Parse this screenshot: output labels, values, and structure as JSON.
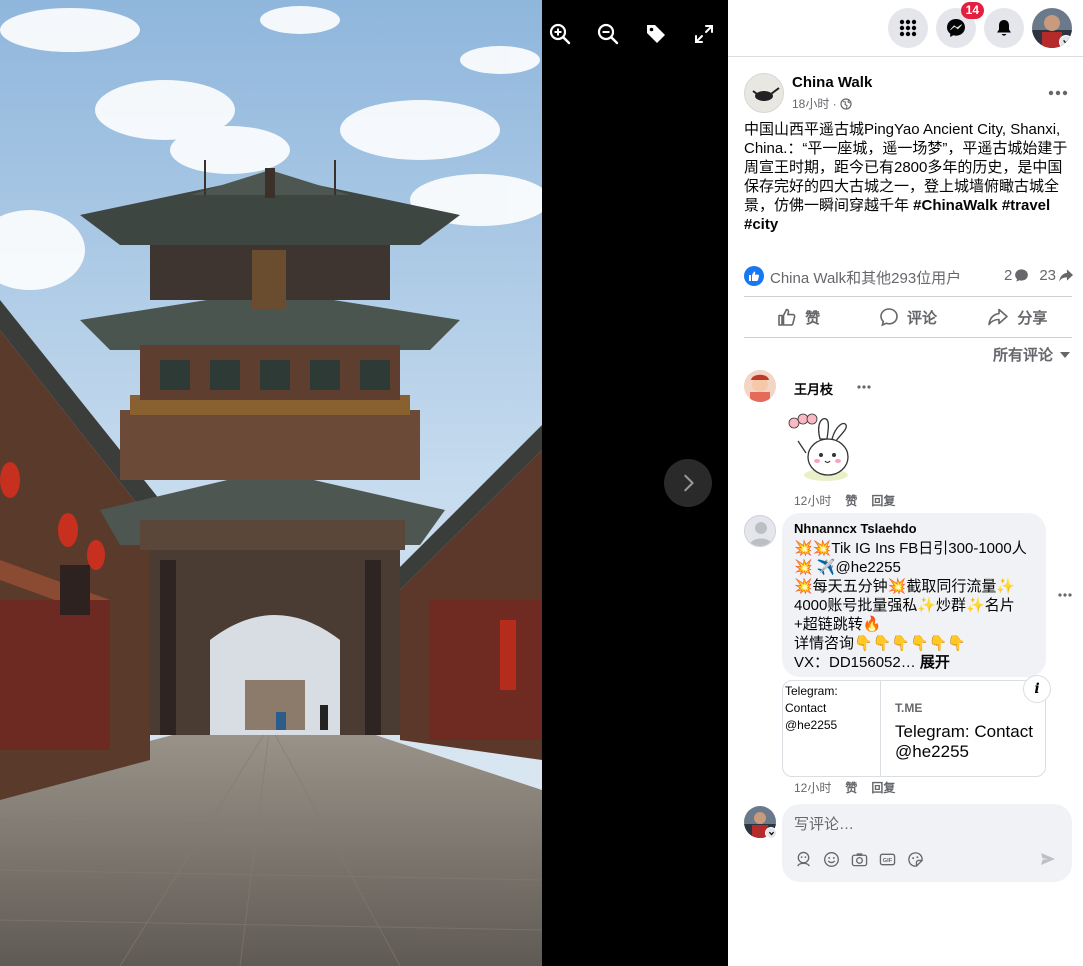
{
  "topbar": {
    "messenger_badge": "14",
    "icons": [
      "menu-grid-icon",
      "messenger-icon",
      "bell-icon"
    ]
  },
  "viewer": {
    "tools": [
      "zoom-in-icon",
      "zoom-out-icon",
      "tag-icon",
      "fullscreen-icon"
    ],
    "next_icon": "chevron-right-icon"
  },
  "post": {
    "page_name": "China Walk",
    "time": "18小时 · ",
    "text": "中国山西平遥古城PingYao Ancient City, Shanxi, China.：“平一座城，遥一场梦”，平遥古城始建于周宣王时期，距今已有2800多年的历史，是中国保存完好的四大古城之一，登上城墙俯瞰古城全景，仿佛一瞬间穿越千年 ",
    "hashtags": [
      "#ChinaWalk",
      "#travel",
      "#city"
    ],
    "reactions_text": "China Walk和其他293位用户",
    "comment_count": "2",
    "share_count": "23"
  },
  "actions": {
    "like": "赞",
    "comment": "评论",
    "share": "分享"
  },
  "sort_label": "所有评论",
  "comments": [
    {
      "author": "王月枝",
      "time": "12小时",
      "like": "赞",
      "reply": "回复"
    },
    {
      "author": "Nhnanncx Tslaehdo",
      "lines": [
        "💥💥Tik IG Ins FB日引300-1000人",
        "💥 ✈️@he2255",
        "💥每天五分钟💥截取同行流量✨",
        "4000账号批量强私✨炒群✨名片",
        "+超链跳转🔥",
        "详情咨询👇👇👇👇👇👇"
      ],
      "last_line": "VX：DD156052… ",
      "expand": "展开",
      "link": {
        "image_alt": "Telegram: Contact @he2255",
        "domain": "T.ME",
        "title": "Telegram: Contact @he2255"
      },
      "time": "12小时",
      "like": "赞",
      "reply": "回复"
    }
  ],
  "composer": {
    "placeholder": "写评论…",
    "icons": [
      "avatar-sticker-icon",
      "emoji-icon",
      "camera-icon",
      "gif-icon",
      "sticker-icon"
    ],
    "send_icon": "send-icon"
  }
}
